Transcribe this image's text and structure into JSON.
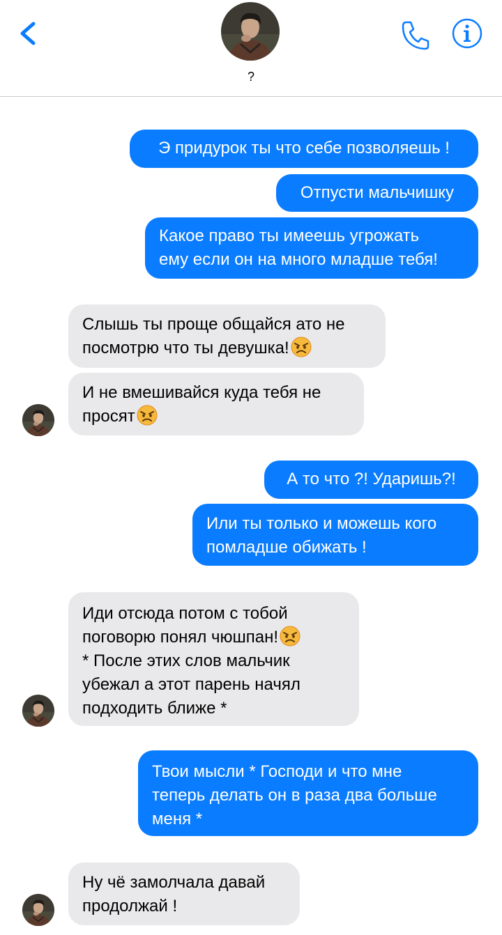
{
  "header": {
    "contact_name": "?",
    "back_icon": "chevron-left-icon",
    "call_icon": "phone-icon",
    "info_icon": "info-icon",
    "accent_color": "#0a7cff"
  },
  "messages": [
    {
      "direction": "out",
      "lines": [
        "Э придурок ты что себе позволяешь !"
      ]
    },
    {
      "direction": "out",
      "lines": [
        "Отпусти мальчишку"
      ]
    },
    {
      "direction": "out",
      "lines": [
        "Какое право ты имеешь угрожать",
        "ему если он на много младше тебя!"
      ]
    },
    {
      "direction": "in",
      "lines": [
        "Слышь ты проще общайся ато не",
        "посмотрю что ты девушка!"
      ],
      "emoji": "angry-face"
    },
    {
      "direction": "in",
      "lines": [
        "И не вмешивайся куда тебя не",
        "просят"
      ],
      "emoji": "angry-face"
    },
    {
      "direction": "out",
      "lines": [
        "А то что ?! Ударишь?!"
      ]
    },
    {
      "direction": "out",
      "lines": [
        "Или ты только и можешь кого",
        "помладше обижать !"
      ]
    },
    {
      "direction": "in",
      "lines": [
        "Иди отсюда потом с тобой",
        "поговорю понял чюшпан!",
        "* После этих слов мальчик",
        "убежал а этот парень начял",
        "подходить ближе *"
      ],
      "emoji": "angry-face"
    },
    {
      "direction": "out",
      "lines": [
        "Твои мысли * Господи и что мне",
        "теперь делать он в раза два больше",
        "меня *"
      ]
    },
    {
      "direction": "in",
      "lines": [
        "Ну чё замолчала давай",
        "продолжай !"
      ]
    }
  ],
  "colors": {
    "outgoing_bubble": "#0a7cff",
    "incoming_bubble": "#e9e9eb"
  }
}
